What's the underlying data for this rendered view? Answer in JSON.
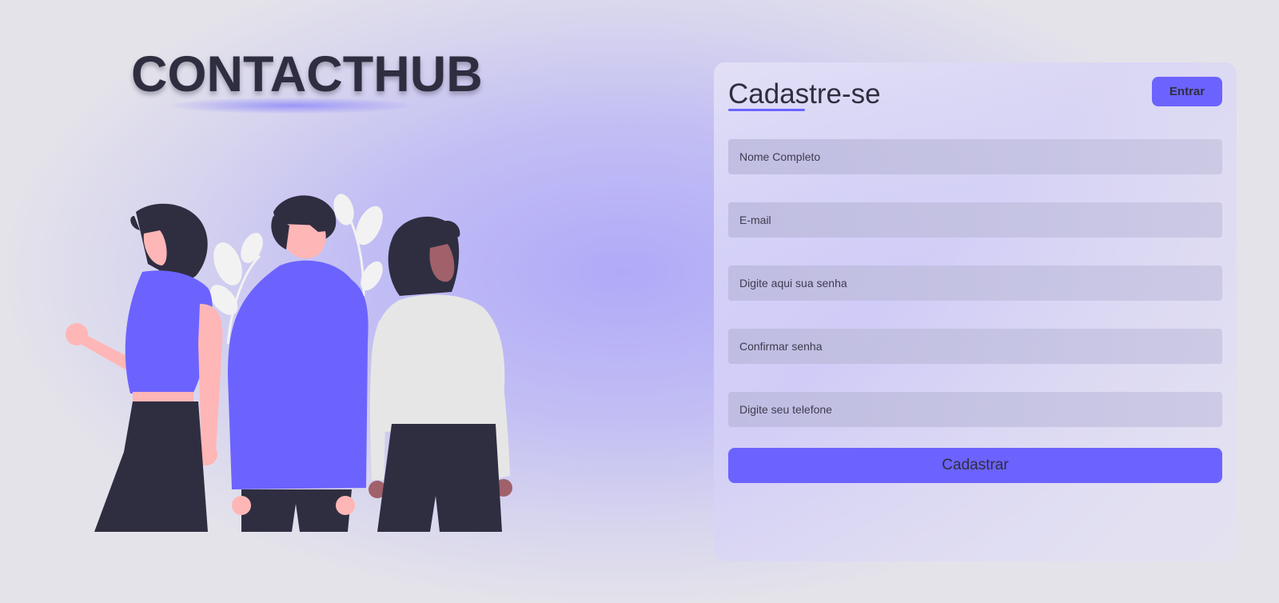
{
  "brand": {
    "title": "CONTACTHUB"
  },
  "illustration": {
    "icon": "team-illustration",
    "colors": {
      "primary": "#6c63ff",
      "dark": "#2f2e41",
      "skin_light": "#ffb6b6",
      "skin_dark": "#a0616a",
      "shirt_light": "#e6e6e6",
      "leaf": "#f2f2f2"
    }
  },
  "register": {
    "title": "Cadastre-se",
    "login_label": "Entrar",
    "fields": {
      "name": {
        "placeholder": "Nome Completo",
        "value": ""
      },
      "email": {
        "placeholder": "E-mail",
        "value": ""
      },
      "password": {
        "placeholder": "Digite aqui sua senha",
        "value": ""
      },
      "confirm_password": {
        "placeholder": "Confirmar senha",
        "value": ""
      },
      "phone": {
        "placeholder": "Digite seu telefone",
        "value": ""
      }
    },
    "submit_label": "Cadastrar"
  },
  "colors": {
    "accent": "#6c63ff",
    "text": "#2f2e41",
    "card_bg": "#e3e1f6",
    "input_bg": "#c4c2e0"
  }
}
